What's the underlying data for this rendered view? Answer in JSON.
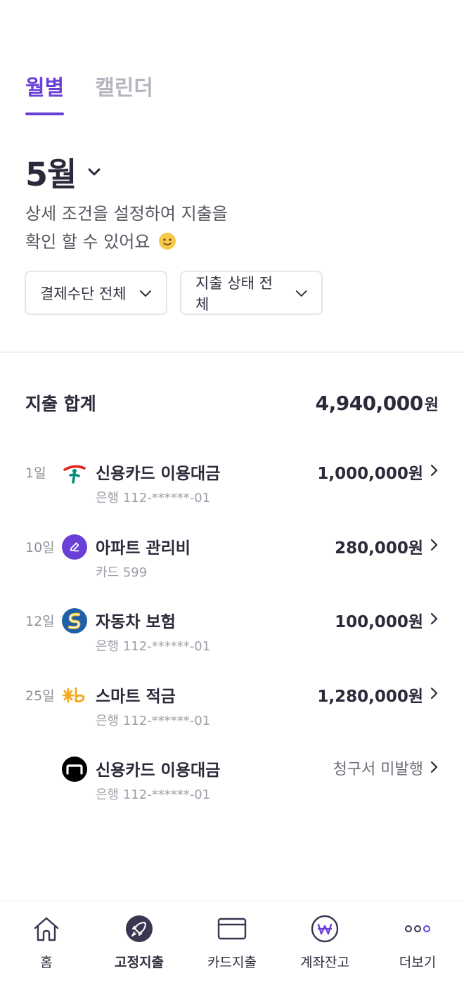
{
  "tabs": [
    {
      "label": "월별",
      "active": true
    },
    {
      "label": "캘린더",
      "active": false
    }
  ],
  "month": {
    "label": "5월"
  },
  "description": {
    "line1": "상세 조건을 설정하여 지출을",
    "line2": "확인 할 수 있어요"
  },
  "filters": {
    "payment_method": "결제수단 전체",
    "status": "지출 상태 전체"
  },
  "total": {
    "label": "지출 합계",
    "amount": "4,940,000",
    "unit": "원"
  },
  "items": [
    {
      "day": "1일",
      "name": "신용카드 이용대금",
      "sub": "은행 112-******-01",
      "amount": "1,000,000",
      "unit": "원",
      "logo": "hana-bank-logo"
    },
    {
      "day": "10일",
      "name": "아파트 관리비",
      "sub": "카드 599",
      "amount": "280,000",
      "unit": "원",
      "logo": "edit-icon"
    },
    {
      "day": "12일",
      "name": "자동차 보험",
      "sub": "은행 112-******-01",
      "amount": "100,000",
      "unit": "원",
      "logo": "shinhan-bank-logo"
    },
    {
      "day": "25일",
      "name": "스마트 적금",
      "sub": "은행 112-******-01",
      "amount": "1,280,000",
      "unit": "원",
      "logo": "kb-bank-logo"
    },
    {
      "day": "",
      "name": "신용카드 이용대금",
      "sub": "은행 112-******-01",
      "amount": "청구서 미발행",
      "unit": "",
      "logo": "card-company-logo"
    }
  ],
  "nav": [
    {
      "label": "홈",
      "icon": "home-icon"
    },
    {
      "label": "고정지출",
      "icon": "rocket-icon",
      "active": true
    },
    {
      "label": "카드지출",
      "icon": "card-icon"
    },
    {
      "label": "계좌잔고",
      "icon": "won-icon"
    },
    {
      "label": "더보기",
      "icon": "more-icon"
    }
  ],
  "colors": {
    "accent": "#6a3fd8",
    "text": "#2a2a3a",
    "muted": "#9e9ea8",
    "nav_dark": "#3a3550"
  }
}
